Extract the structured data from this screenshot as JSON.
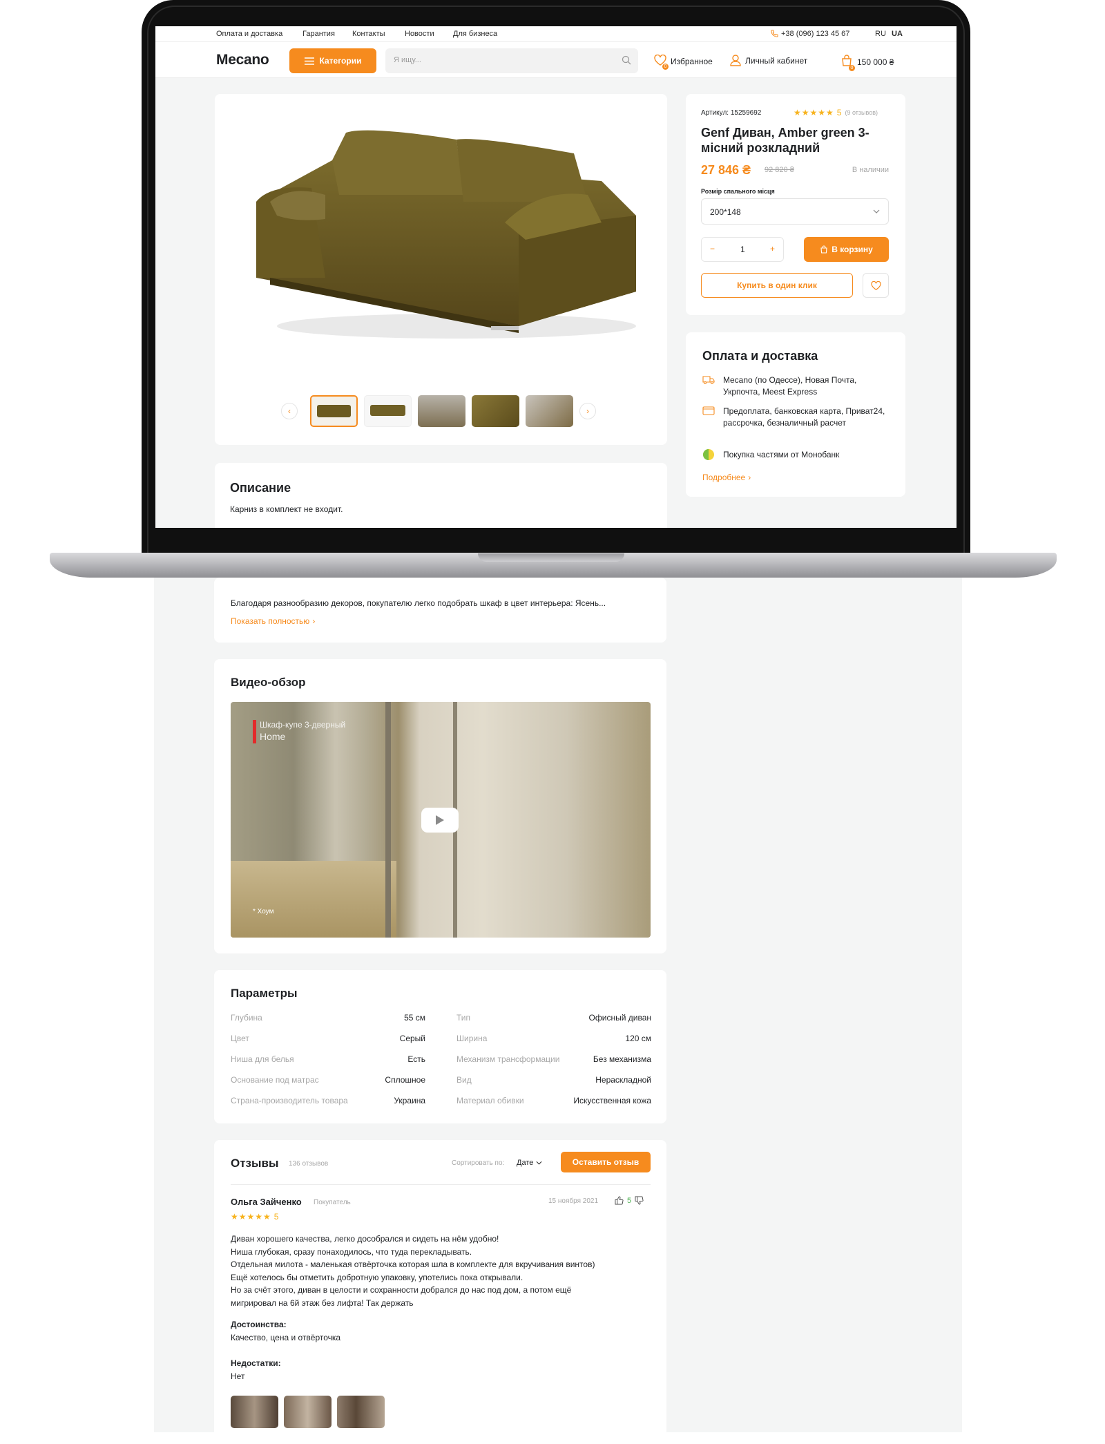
{
  "topbar": {
    "links": [
      "Оплата и доставка",
      "Гарантия",
      "Контакты",
      "Новости",
      "Для бизнеса"
    ],
    "phone": "+38 (096) 123 45 67",
    "lang_ru": "RU",
    "lang_ua": "UA"
  },
  "header": {
    "logo": "Mecano",
    "categories_label": "Категории",
    "search_placeholder": "Я ищу...",
    "favorites_label": "Избранное",
    "favorites_count": "0",
    "account_label": "Личный кабинет",
    "cart_count": "0",
    "cart_total": "150 000 ₴"
  },
  "product": {
    "sku": "Артикул: 15259692",
    "rating": "5",
    "reviews_count": "(9 отзывов)",
    "title": "Genf Диван, Amber green 3-місний розкладний",
    "price": "27 846 ₴",
    "old_price": "92 820 ₴",
    "stock": "В наличии",
    "size_label": "Розмір спального місця",
    "size_value": "200*148",
    "qty": "1",
    "qty_minus": "−",
    "qty_plus": "+",
    "add_to_cart": "В корзину",
    "buy_one_click": "Купить в один клик"
  },
  "delivery": {
    "title": "Оплата и доставка",
    "items": [
      "Mecano (по Одессе), Новая Почта, Укрпочта, Meest Express",
      "Предоплата, банковская карта, Приват24, рассрочка, безналичный расчет",
      "Покупка частями от Монобанк"
    ],
    "more": "Подробнее"
  },
  "description": {
    "title": "Описание",
    "text1": "Карниз в комплект не входит.",
    "text2": "Благодаря разнообразию декоров, покупателю легко подобрать шкаф в цвет интерьера: Ясень...",
    "show_all": "Показать полностью"
  },
  "video": {
    "title": "Видео-обзор",
    "overlay_line1": "Шкаф-купе 3-дверный",
    "overlay_line2": "Home",
    "caption": "* Хоум"
  },
  "params": {
    "title": "Параметры",
    "left": [
      {
        "label": "Глубина",
        "value": "55 см"
      },
      {
        "label": "Цвет",
        "value": "Серый"
      },
      {
        "label": "Ниша для белья",
        "value": "Есть"
      },
      {
        "label": "Основание под матрас",
        "value": "Сплошное"
      },
      {
        "label": "Страна-производитель товара",
        "value": "Украина"
      }
    ],
    "right": [
      {
        "label": "Тип",
        "value": "Офисный диван"
      },
      {
        "label": "Ширина",
        "value": "120 см"
      },
      {
        "label": "Механизм трансформации",
        "value": "Без механизма"
      },
      {
        "label": "Вид",
        "value": "Нераскладной"
      },
      {
        "label": "Материал обивки",
        "value": "Искусственная кожа"
      }
    ]
  },
  "reviews": {
    "title": "Отзывы",
    "count": "136 отзывов",
    "sort_label": "Сортировать по:",
    "sort_value": "Дате",
    "leave_review": "Оставить отзыв",
    "review": {
      "author": "Ольга Зайченко",
      "role": "Покупатель",
      "date": "15 ноября 2021",
      "likes": "5",
      "rating": "5",
      "lines": [
        "Диван хорошего качества, легко дособрался и сидеть на нём удобно!",
        "Ниша глубокая, сразу понаходилось, что туда перекладывать.",
        "Отдельная милота - маленькая отвёрточка которая шла в комплекте для вкручивания винтов)",
        "Ещё хотелось бы отметить добротную упаковку, употелись пока открывали.",
        "Но за счёт этого, диван в целости и сохранности добрался до нас под дом, а потом ещё",
        "мигрировал на 6й этаж без лифта! Так держать"
      ],
      "pros_label": "Достоинства:",
      "pros": "Качество, цена и отвёрточка",
      "cons_label": "Недостатки:",
      "cons": "Нет"
    }
  },
  "colors": {
    "accent": "#f68b1e",
    "stars": "#f7b31e",
    "sofa": "#6b5a20"
  }
}
